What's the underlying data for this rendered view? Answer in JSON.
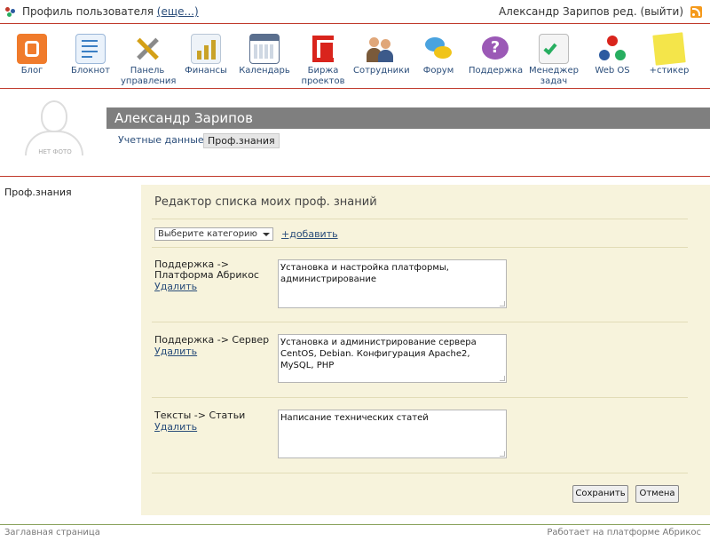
{
  "topbar": {
    "title": "Профиль пользователя",
    "more_link": "(еще...)",
    "user_name": "Александр Зарипов",
    "edit_link": "ред.",
    "logout_link": "(выйти)"
  },
  "toolbar": {
    "items": [
      {
        "label": "Блог",
        "icon": "blogger-icon",
        "color": "#f07b2b"
      },
      {
        "label": "Блокнот",
        "icon": "notepad-icon",
        "color": "#3b7fc4"
      },
      {
        "label": "Панель управления",
        "icon": "tools-icon",
        "color": "#8a8a8a"
      },
      {
        "label": "Финансы",
        "icon": "finance-chart-icon",
        "color": "#c9a227"
      },
      {
        "label": "Календарь",
        "icon": "calendar-icon",
        "color": "#5a6f8e"
      },
      {
        "label": "Биржа проектов",
        "icon": "exchange-logo-icon",
        "color": "#d9241c"
      },
      {
        "label": "Сотрудники",
        "icon": "people-icon",
        "color": "#7a5a3a"
      },
      {
        "label": "Форум",
        "icon": "chat-bubbles-icon",
        "color": "#4aa3df"
      },
      {
        "label": "Поддержка",
        "icon": "question-icon",
        "color": "#9b59b6"
      },
      {
        "label": "Менеджер задач",
        "icon": "task-check-icon",
        "color": "#27ae60"
      },
      {
        "label": "Web OS",
        "icon": "molecule-icon",
        "color": "#2c5aa0"
      },
      {
        "label": "+стикер",
        "icon": "sticky-note-icon",
        "color": "#f4e54a"
      }
    ]
  },
  "profile": {
    "no_photo": "НЕТ ФОТО",
    "name": "Александр Зарипов",
    "tab_account": "Учетные данные",
    "tab_skills": "Проф.знания"
  },
  "sidebar": {
    "item": "Проф.знания"
  },
  "editor": {
    "heading": "Редактор списка моих проф. знаний",
    "category_select": "Выберите категорию",
    "add_link": "+добавить",
    "delete_label": "Удалить",
    "rows": [
      {
        "label": "Поддержка -> Платформа Абрикос",
        "text": "Установка и настройка платформы, администрирование"
      },
      {
        "label": "Поддержка -> Сервер",
        "text": "Установка и администрирование сервера CentOS, Debian. Конфигурация Apache2, MySQL, PHP"
      },
      {
        "label": "Тексты -> Статьи",
        "text": "Написание технических статей"
      }
    ],
    "save_button": "Сохранить",
    "cancel_button": "Отмена"
  },
  "footer": {
    "left": "Заглавная страница",
    "right": "Работает на платформе Абрикос"
  },
  "colors": {
    "accent_line": "#c0392b",
    "panel_bg": "#f7f3dc",
    "name_bar": "#7f7f7f",
    "link": "#2a4d7a"
  }
}
